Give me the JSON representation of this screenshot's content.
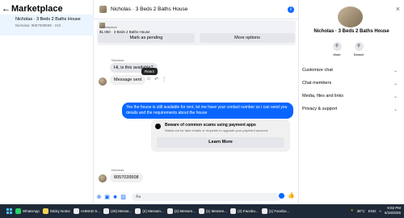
{
  "left": {
    "title": "Marketplace",
    "conversation": {
      "title": "Nicholas · 3 Beds 2 Baths House",
      "subtitle": "Nicholas: 8057039508 · 21h"
    }
  },
  "chat": {
    "title": "Nicholas · 3 Beds 2 Baths House",
    "listing": {
      "label": "Marketplace",
      "price": "$1,050 · 3 Beds 2 Baths House"
    },
    "mark_pending": "Mark as pending",
    "more_options": "More options",
    "messages": [
      {
        "sender": "Nicholas",
        "text": "Hi, is this available?"
      },
      {
        "text": "Message sent"
      },
      {
        "text": "Yes the house is still available for rent, let me have your contact number so i can send you details and the requirements about the house"
      },
      {
        "sender": "Nicholas",
        "text": "8057039508"
      }
    ],
    "tooltip": "React",
    "scam_card": {
      "title": "Beware of common scams using payment apps",
      "desc": "Watch out for fake emails or requests to upgrade your payment account.",
      "button": "Learn More"
    },
    "composer_placeholder": "Aa"
  },
  "right": {
    "name": "Nicholas · 3 Beds 2 Baths House",
    "mute": "Mute",
    "search": "Search",
    "menu": [
      "Customize chat",
      "Chat members",
      "Media, files and links",
      "Privacy & support"
    ]
  },
  "taskbar": {
    "apps": [
      {
        "label": "WhatsApp",
        "color": "#25d366"
      },
      {
        "label": "Sticky Notes",
        "color": "#f7d354"
      },
      {
        "label": "AHMAD S...",
        "color": "#e8eaed"
      },
      {
        "label": "(20) Messe...",
        "color": "#e8eaed"
      },
      {
        "label": "(2) Messen...",
        "color": "#e8eaed"
      },
      {
        "label": "(2) Messen...",
        "color": "#e8eaed"
      },
      {
        "label": "(1) Messen...",
        "color": "#e8eaed"
      },
      {
        "label": "(2) Facebo...",
        "color": "#e8eaed"
      },
      {
        "label": "(1) Facebo...",
        "color": "#e8eaed"
      }
    ],
    "weather": "38°C",
    "lang": "ENG",
    "time": "9:02 PM",
    "date": "6/18/2025"
  }
}
